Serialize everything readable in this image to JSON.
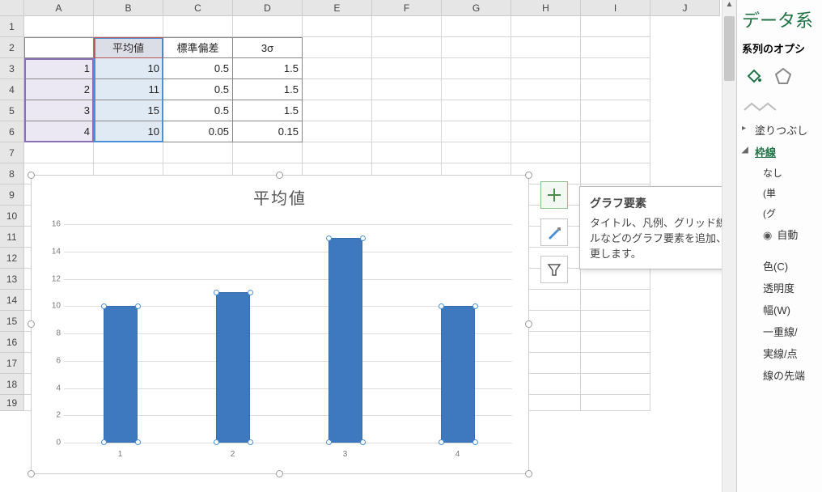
{
  "columns": [
    "A",
    "B",
    "C",
    "D",
    "E",
    "F",
    "G",
    "H",
    "I",
    "J"
  ],
  "row_labels": [
    "1",
    "2",
    "3",
    "4",
    "5",
    "6",
    "7",
    "8",
    "9",
    "10",
    "11",
    "12",
    "13",
    "14",
    "15",
    "16",
    "17",
    "18",
    "19"
  ],
  "table": {
    "headers": {
      "b": "平均値",
      "c": "標準偏差",
      "d": "3σ"
    },
    "rows": [
      {
        "a": "1",
        "b": "10",
        "c": "0.5",
        "d": "1.5"
      },
      {
        "a": "2",
        "b": "11",
        "c": "0.5",
        "d": "1.5"
      },
      {
        "a": "3",
        "b": "15",
        "c": "0.5",
        "d": "1.5"
      },
      {
        "a": "4",
        "b": "10",
        "c": "0.05",
        "d": "0.15"
      }
    ]
  },
  "chart_data": {
    "type": "bar",
    "title": "平均値",
    "categories": [
      "1",
      "2",
      "3",
      "4"
    ],
    "values": [
      10,
      11,
      15,
      10
    ],
    "ylim": [
      0,
      16
    ],
    "yticks": [
      0,
      2,
      4,
      6,
      8,
      10,
      12,
      14,
      16
    ]
  },
  "chart_tools": {
    "selected": 0,
    "tooltip_title": "グラフ要素",
    "tooltip_body": "タイトル、凡例、グリッド線、データ ラベルなどのグラフ要素を追加、削除、または変更します。"
  },
  "sidebar": {
    "title": "データ系",
    "subtitle": "系列のオプシ",
    "sections": {
      "fill": "塗りつぶし",
      "line": "枠線",
      "auto": "自動",
      "color": "色(C)",
      "transparency": "透明度",
      "width": "幅(W)",
      "dash": "一重線/",
      "compound": "実線/点",
      "arrow": "線の先端",
      "truncated1": "なし",
      "truncated2": "(単",
      "truncated3": "(グ"
    }
  }
}
